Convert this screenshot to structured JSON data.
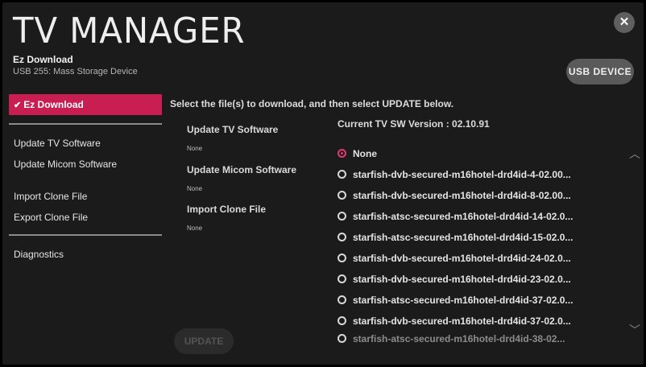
{
  "header": {
    "title": "TV MANAGER",
    "subtitle": "Ez Download",
    "device": "USB 255: Mass Storage Device",
    "close_icon": "close-icon",
    "usb_button": "USB DEVICE"
  },
  "sidebar": {
    "items": [
      {
        "label": "Ez Download",
        "active": true
      },
      {
        "label": "Update TV Software"
      },
      {
        "label": "Update Micom Software"
      },
      {
        "label": "Import Clone File"
      },
      {
        "label": "Export Clone File"
      },
      {
        "label": "Diagnostics"
      }
    ],
    "check_glyph": "✔"
  },
  "main": {
    "instruction": "Select the file(s) to download, and then select UPDATE below.",
    "categories": [
      {
        "label": "Update TV Software",
        "value": "None"
      },
      {
        "label": "Update Micom Software",
        "value": "None"
      },
      {
        "label": "Import Clone File",
        "value": "None"
      }
    ],
    "current_version": "Current TV SW Version :  02.10.91",
    "files": [
      {
        "name": "None",
        "selected": true
      },
      {
        "name": "starfish-dvb-secured-m16hotel-drd4id-4-02.00..."
      },
      {
        "name": "starfish-dvb-secured-m16hotel-drd4id-8-02.00..."
      },
      {
        "name": "starfish-atsc-secured-m16hotel-drd4id-14-02.0..."
      },
      {
        "name": "starfish-atsc-secured-m16hotel-drd4id-15-02.0..."
      },
      {
        "name": "starfish-dvb-secured-m16hotel-drd4id-24-02.0..."
      },
      {
        "name": "starfish-dvb-secured-m16hotel-drd4id-23-02.0..."
      },
      {
        "name": "starfish-atsc-secured-m16hotel-drd4id-37-02.0..."
      },
      {
        "name": "starfish-dvb-secured-m16hotel-drd4id-37-02.0..."
      },
      {
        "name": "starfish-atsc-secured-m16hotel-drd4id-38-02..."
      }
    ],
    "update_button": "UPDATE",
    "scroll_up_glyph": "︿",
    "scroll_down_glyph": "﹀"
  },
  "colors": {
    "accent": "#c81e52",
    "background": "#1b1b1b"
  }
}
